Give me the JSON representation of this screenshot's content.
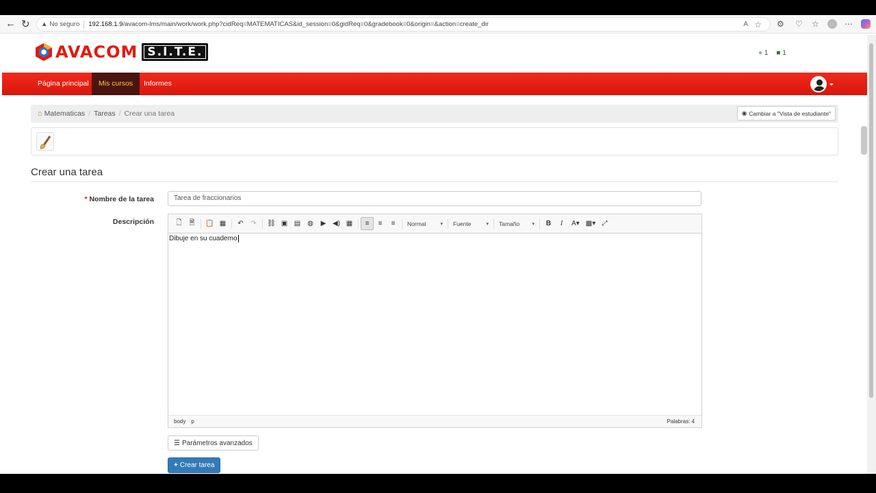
{
  "browser": {
    "security_label": "No seguro",
    "url_host": "192.168.1.9",
    "url_path": "/avacom-lms/main/work/work.php?cidReq=MATEMATICAS&id_session=0&gidReq=0&gradebook=0&origin=&action=create_dir"
  },
  "header": {
    "logo_word": "AVACOM",
    "logo_badge": "S.I.T.E.",
    "users_count": "1",
    "messages_count": "1"
  },
  "nav": {
    "items": [
      {
        "label": "Página principal"
      },
      {
        "label": "Mis cursos"
      },
      {
        "label": "Informes"
      }
    ]
  },
  "breadcrumb": {
    "course": "Matematicas",
    "section": "Tareas",
    "current": "Crear una tarea",
    "student_view": "Cambiar a \"Vista de estudiante\""
  },
  "form": {
    "title": "Crear una tarea",
    "name_required": "*",
    "name_label": "Nombre de la tarea",
    "name_value": "Tarea de fraccionarios",
    "description_label": "Descripción",
    "description_text": "Dibuje en su cuademo",
    "format_combo": "Normal",
    "font_combo": "Fuente",
    "size_combo": "Tamaño",
    "status_body": "body",
    "status_p": "p",
    "word_count": "Palabras: 4",
    "advanced_button": "Parámetros avanzados",
    "create_button": "Crear tarea"
  },
  "colors": {
    "brand_red": "#e31b0f",
    "nav_active_bg": "#4a1410",
    "nav_active_text": "#f7c845",
    "primary_button": "#337ab7"
  }
}
